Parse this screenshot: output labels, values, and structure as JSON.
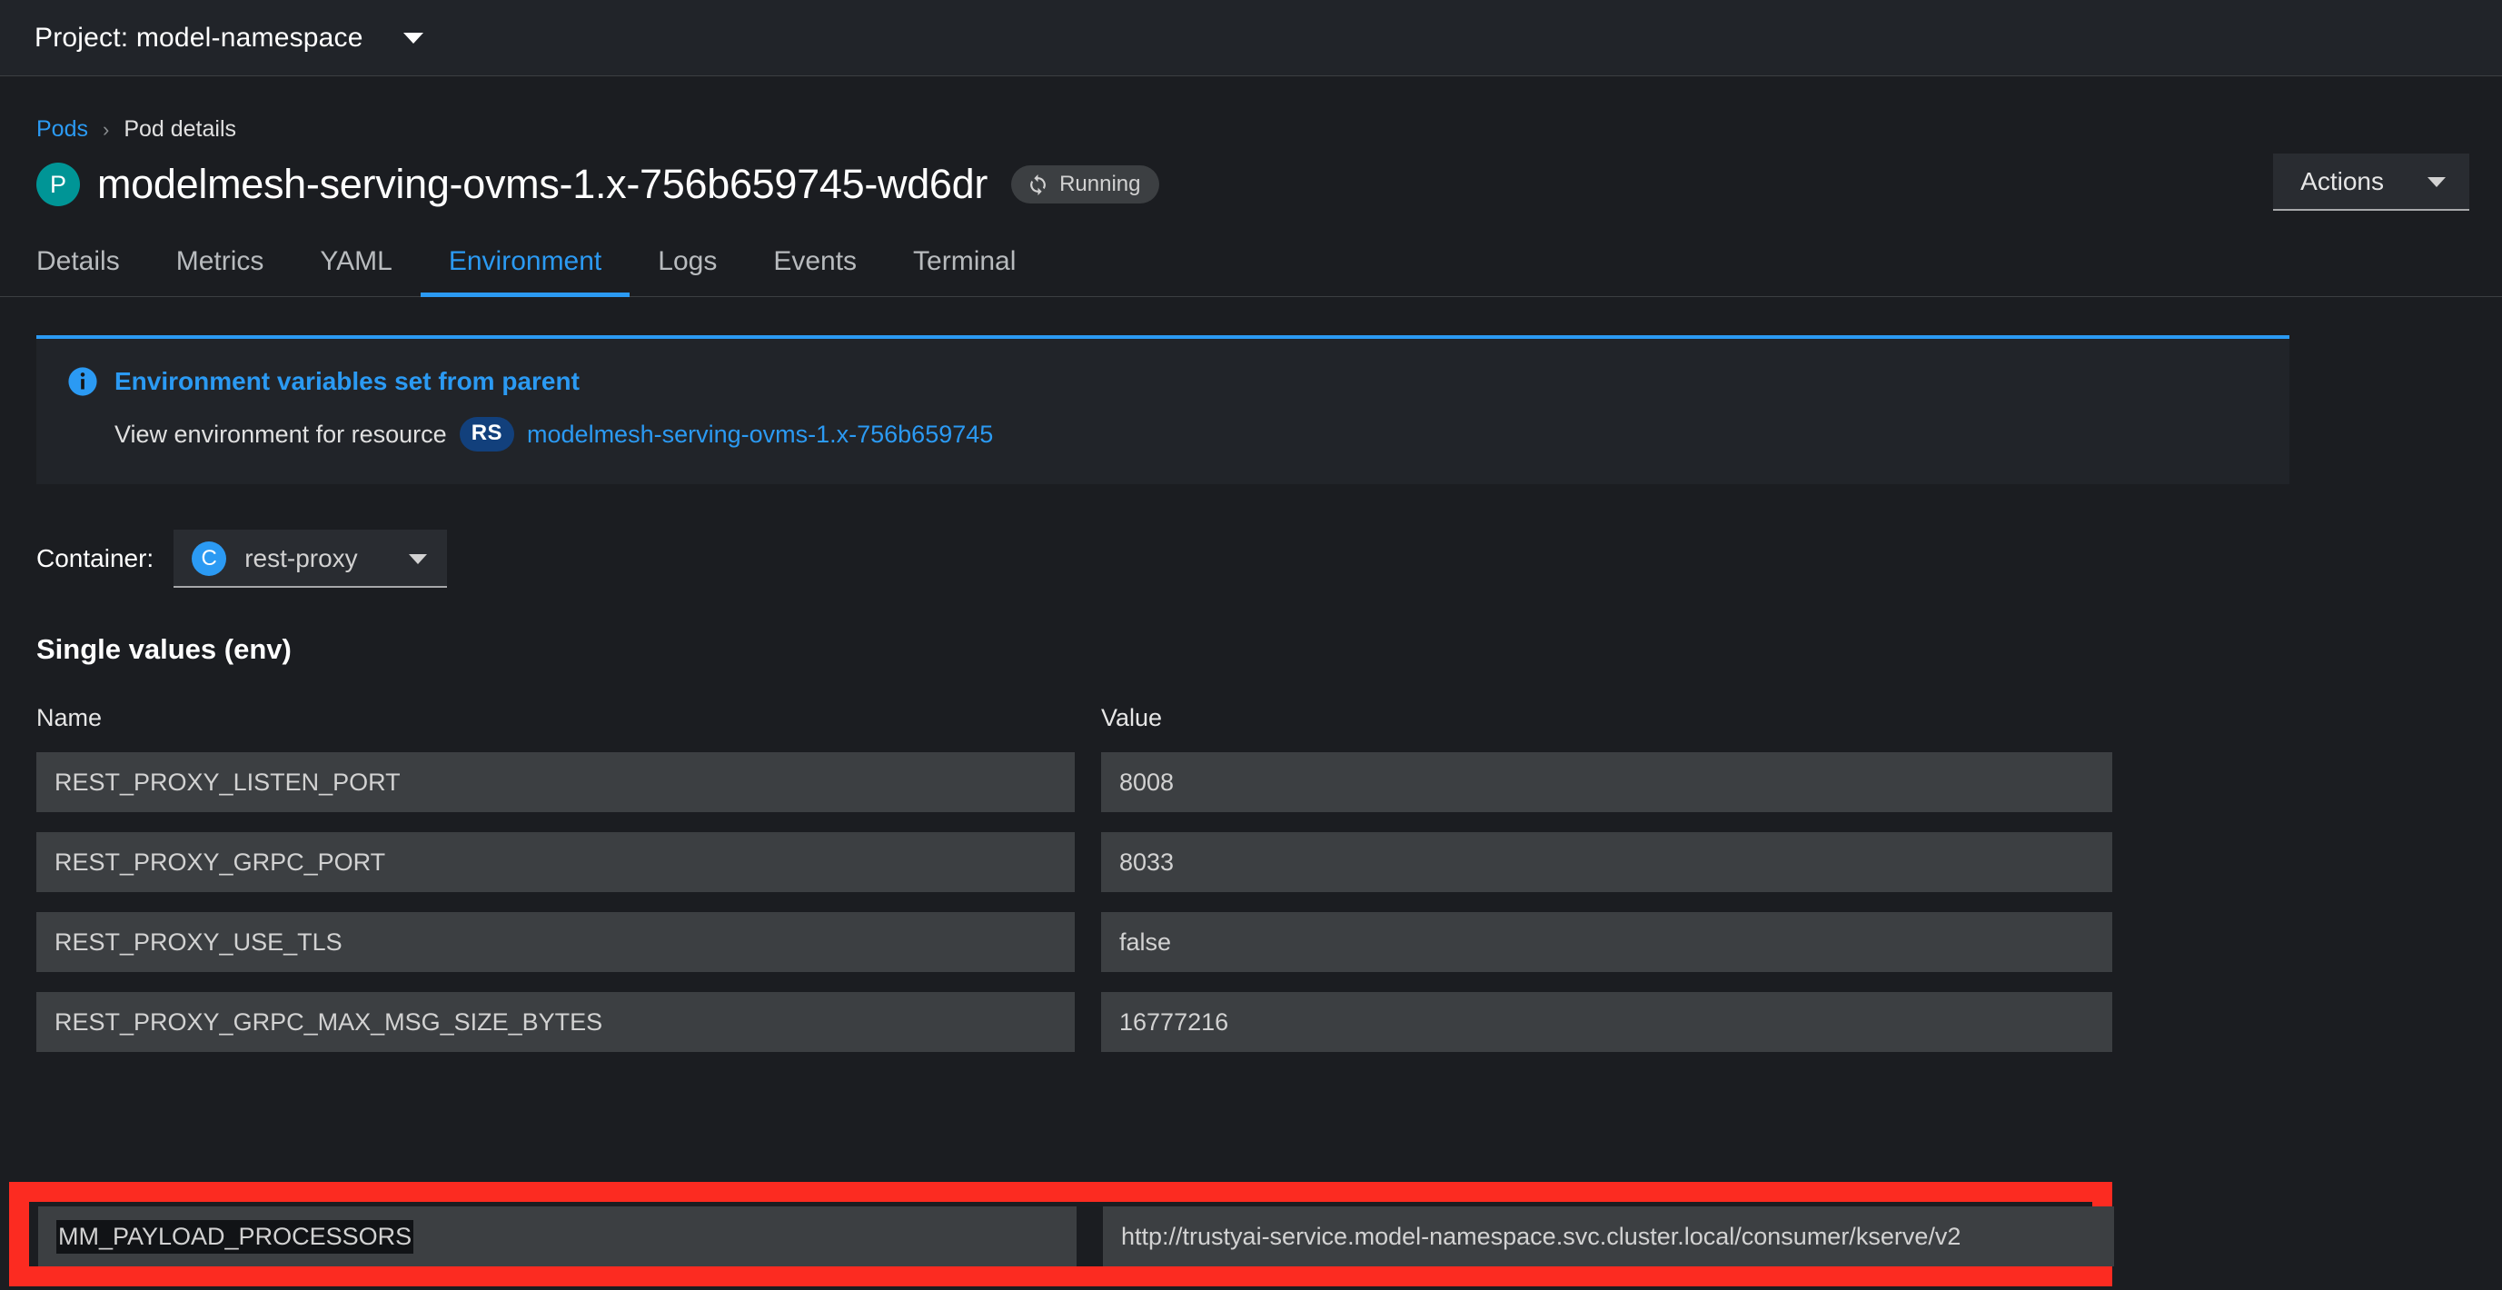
{
  "project_bar": {
    "label": "Project: model-namespace",
    "caret_icon": "chevron-down-icon"
  },
  "breadcrumb": {
    "parent": "Pods",
    "separator": "›",
    "current": "Pod details"
  },
  "header": {
    "resource_kind_abbrev": "P",
    "title": "modelmesh-serving-ovms-1.x-756b659745-wd6dr",
    "status": "Running",
    "status_icon": "sync-icon",
    "actions_label": "Actions"
  },
  "tabs": [
    {
      "label": "Details",
      "active": false
    },
    {
      "label": "Metrics",
      "active": false
    },
    {
      "label": "YAML",
      "active": false
    },
    {
      "label": "Environment",
      "active": true
    },
    {
      "label": "Logs",
      "active": false
    },
    {
      "label": "Events",
      "active": false
    },
    {
      "label": "Terminal",
      "active": false
    }
  ],
  "alert": {
    "icon": "info-circle-icon",
    "title": "Environment variables set from parent",
    "body_prefix": "View environment for resource",
    "resource_kind_abbrev": "RS",
    "resource_link": "modelmesh-serving-ovms-1.x-756b659745"
  },
  "container_selector": {
    "label": "Container:",
    "kind_abbrev": "C",
    "value": "rest-proxy",
    "caret_icon": "chevron-down-icon"
  },
  "env_section": {
    "title": "Single values (env)",
    "columns": {
      "name": "Name",
      "value": "Value"
    },
    "rows": [
      {
        "name": "REST_PROXY_LISTEN_PORT",
        "value": "8008",
        "highlighted": false,
        "name_selected": false
      },
      {
        "name": "REST_PROXY_GRPC_PORT",
        "value": "8033",
        "highlighted": false,
        "name_selected": false
      },
      {
        "name": "REST_PROXY_USE_TLS",
        "value": "false",
        "highlighted": false,
        "name_selected": false
      },
      {
        "name": "REST_PROXY_GRPC_MAX_MSG_SIZE_BYTES",
        "value": "16777216",
        "highlighted": false,
        "name_selected": false
      },
      {
        "name": "MM_PAYLOAD_PROCESSORS",
        "value": "http://trustyai-service.model-namespace.svc.cluster.local/consumer/kserve/v2",
        "highlighted": true,
        "name_selected": true
      }
    ]
  },
  "colors": {
    "page_background": "#1b1d21",
    "panel_background": "#212429",
    "input_background": "#3c3f42",
    "accent_blue": "#2b9af3",
    "pod_teal": "#009596",
    "rs_badge_blue": "#12407c",
    "highlight_red": "#fc2b21"
  }
}
